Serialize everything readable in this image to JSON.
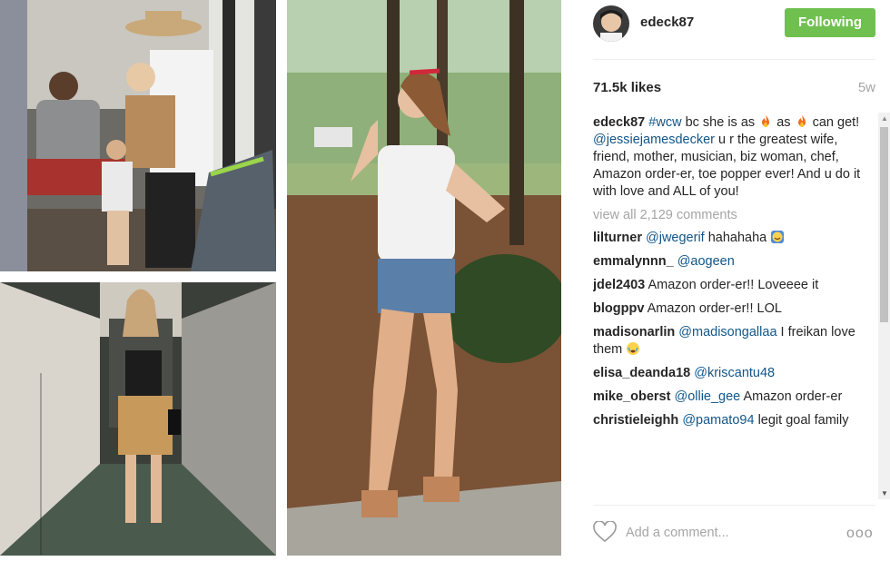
{
  "post": {
    "username": "edeck87",
    "follow_label": "Following",
    "likes": "71.5k likes",
    "age": "5w"
  },
  "caption": {
    "user": "edeck87",
    "hashtag": "#wcw",
    "t1": "bc she is as",
    "t2": "as",
    "t3": "can get!",
    "mention": "@jessiejamesdecker",
    "t4": "u r the greatest wife, friend, mother, musician, biz woman, chef, Amazon order-er, toe popper ever! And u do it with love and ALL of you!"
  },
  "view_all": "view all 2,129 comments",
  "comments": [
    {
      "user": "lilturner",
      "mention": "@jwegerif",
      "text": "hahahaha"
    },
    {
      "user": "emmalynnn_",
      "mention": "@aogeen",
      "text": ""
    },
    {
      "user": "jdel2403",
      "mention": "",
      "text": "Amazon order-er!! Loveeee it"
    },
    {
      "user": "blogppv",
      "mention": "",
      "text": "Amazon order-er!! LOL"
    },
    {
      "user": "madisonarlin",
      "mention": "@madisongallaa",
      "text": "I freikan love them"
    },
    {
      "user": "elisa_deanda18",
      "mention": "@kriscantu48",
      "text": ""
    },
    {
      "user": "mike_oberst",
      "mention": "@ollie_gee",
      "text": "Amazon order-er"
    },
    {
      "user": "christieleighh",
      "mention": "@pamato94",
      "text": "legit goal family"
    }
  ],
  "footer": {
    "add_comment_placeholder": "Add a comment...",
    "more_label": "ooo"
  },
  "colors": {
    "follow_green": "#70c050",
    "mention_blue": "#125688",
    "muted_gray": "#a5a5a5"
  }
}
